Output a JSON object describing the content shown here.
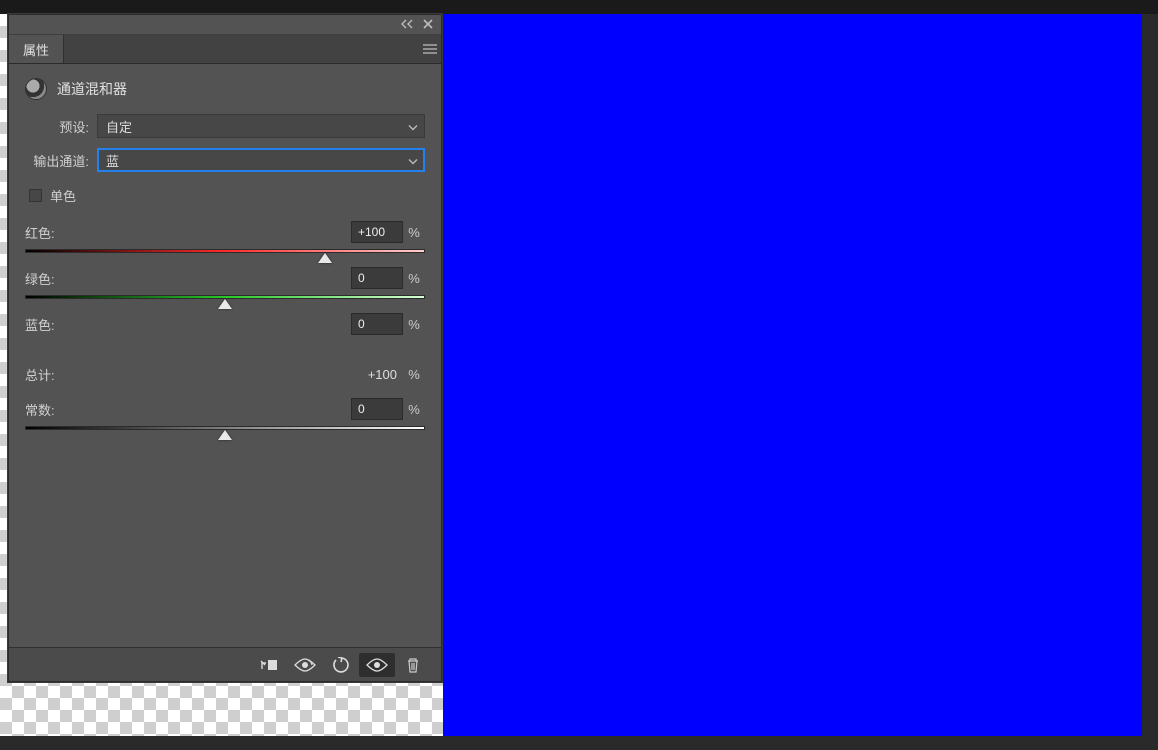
{
  "panel": {
    "tab_title": "属性",
    "adjustment_title": "通道混和器",
    "preset_label": "预设:",
    "preset_value": "自定",
    "output_label": "输出通道:",
    "output_value": "蓝",
    "monochrome_label": "单色",
    "percent_symbol": "%",
    "sliders": {
      "red": {
        "label": "红色:",
        "value": "+100",
        "position_pct": 75
      },
      "green": {
        "label": "绿色:",
        "value": "0",
        "position_pct": 50
      },
      "blue": {
        "label": "蓝色:",
        "value": "0",
        "position_pct": 50
      }
    },
    "total": {
      "label": "总计:",
      "value": "+100"
    },
    "constant": {
      "label": "常数:",
      "value": "0",
      "position_pct": 50
    }
  },
  "canvas": {
    "fill_color": "#0000ff"
  }
}
